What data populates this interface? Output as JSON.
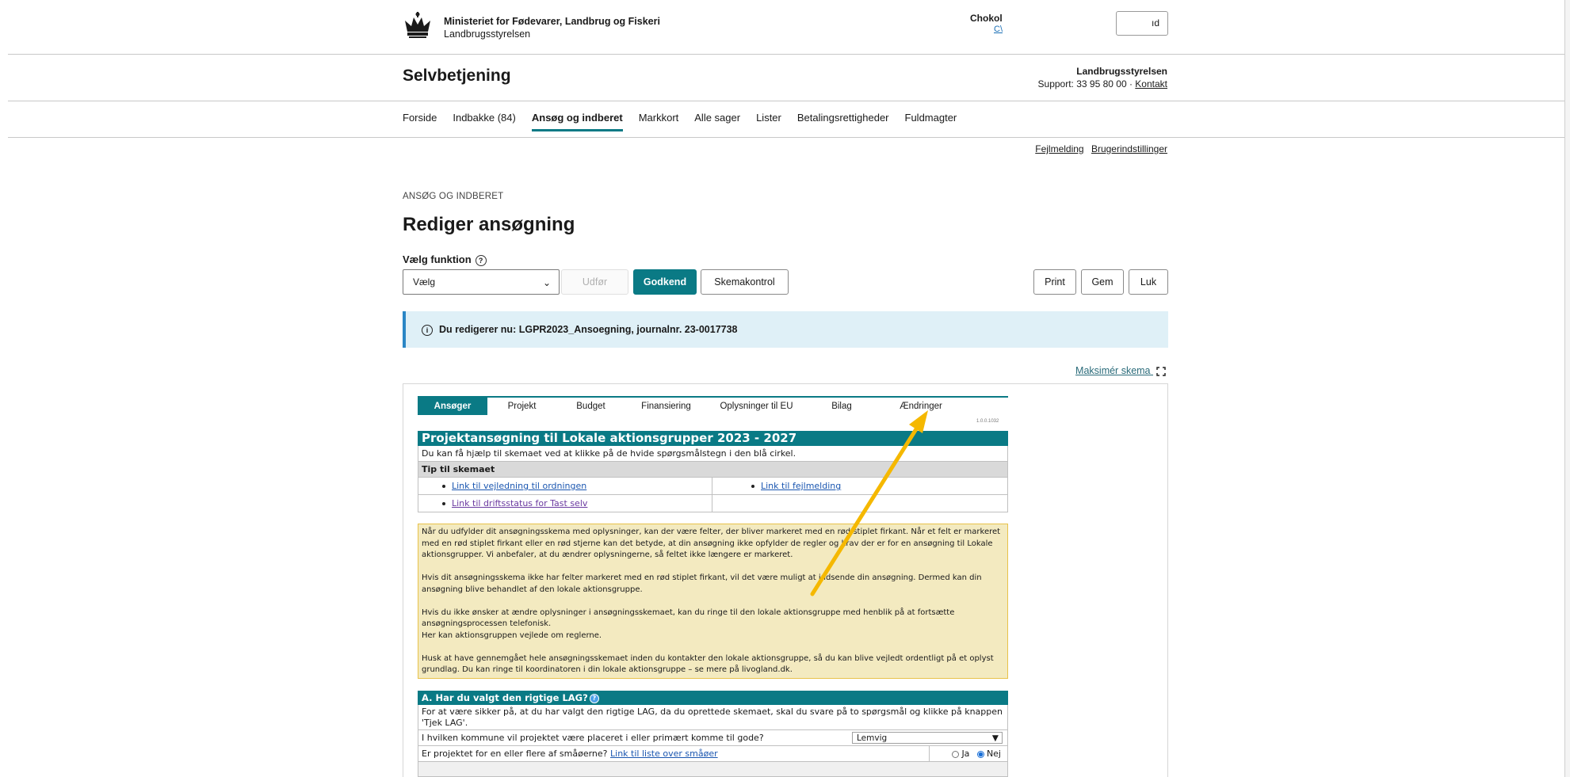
{
  "header": {
    "ministry_name": "Ministeriet for Fødevarer, Landbrug og Fiskeri",
    "agency_name": "Landbrugsstyrelsen",
    "user_name": "Chokol",
    "user_link": "C\\",
    "logout_label": "ıd"
  },
  "app": {
    "title": "Selvbetjening",
    "support_org": "Landbrugsstyrelsen",
    "support_prefix": "Support: 33 95 80 00 · ",
    "support_contact": "Kontakt"
  },
  "nav": {
    "items": [
      {
        "label": "Forside",
        "active": false
      },
      {
        "label": "Indbakke (84)",
        "active": false
      },
      {
        "label": "Ansøg og indberet",
        "active": true
      },
      {
        "label": "Markkort",
        "active": false
      },
      {
        "label": "Alle sager",
        "active": false
      },
      {
        "label": "Lister",
        "active": false
      },
      {
        "label": "Betalingsrettigheder",
        "active": false
      },
      {
        "label": "Fuldmagter",
        "active": false
      }
    ],
    "util_links": [
      "Fejlmelding",
      "Brugerindstillinger"
    ]
  },
  "page": {
    "breadcrumb": "ANSØG OG INDBERET",
    "title": "Rediger ansøgning",
    "function_label": "Vælg funktion",
    "select_value": "Vælg",
    "execute_label": "Udfør",
    "approve_label": "Godkend",
    "check_label": "Skemakontrol",
    "print_label": "Print",
    "save_label": "Gem",
    "close_label": "Luk",
    "info_banner": "Du redigerer nu: LGPR2023_Ansoegning, journalnr. 23-0017738",
    "maximize_label": "Maksimér skema"
  },
  "form": {
    "tabs": [
      "Ansøger",
      "Projekt",
      "Budget",
      "Finansiering",
      "Oplysninger til EU",
      "Bilag",
      "Ændringer"
    ],
    "active_tab": 0,
    "version": "1.0.0.1032",
    "title": "Projektansøgning til Lokale aktionsgrupper 2023 - 2027",
    "help_text": "Du kan få hjælp til skemaet ved at klikke på de hvide spørgsmålstegn i den blå cirkel.",
    "tip_header": "Tip til skemaet",
    "links": {
      "guide": "Link til vejledning til ordningen",
      "error_report": "Link til fejlmelding",
      "status": "Link til driftsstatus for Tast selv"
    },
    "note_paragraphs": [
      "Når du udfylder dit ansøgningsskema med oplysninger, kan der være felter, der bliver markeret med en rød stiplet firkant. Når et felt er markeret med en rød stiplet firkant eller en rød stjerne kan det betyde, at din ansøgning ikke opfylder de regler og krav der er for en ansøgning til Lokale aktionsgrupper. Vi anbefaler, at du ændrer oplysningerne, så feltet ikke længere er markeret.",
      "Hvis dit ansøgningsskema ikke har felter markeret med en rød stiplet firkant, vil det være muligt at indsende din ansøgning. Dermed kan din ansøgning blive behandlet af den lokale aktionsgruppe.",
      "Hvis du ikke ønsker at ændre oplysninger i ansøgningsskemaet, kan du ringe til den lokale aktionsgruppe med henblik på at fortsætte ansøgningsprocessen telefonisk.\nHer kan aktionsgruppen vejlede om reglerne.",
      "Husk at have gennemgået hele ansøgningsskemaet inden du kontakter den lokale aktionsgruppe, så du kan blive vejledt ordentligt på et oplyst grundlag. Du kan ringe til koordinatoren i din lokale aktionsgruppe – se mere på livogland.dk."
    ],
    "section_a_title": "A. Har du valgt den rigtige LAG?",
    "section_a_desc": "For at være sikker på, at du har valgt den rigtige LAG, da du oprettede skemaet, skal du svare på to spørgsmål og klikke på knappen 'Tjek LAG'.",
    "q1_label": "I hvilken kommune vil projektet være placeret i eller primært komme til gode?",
    "q1_value": "Lemvig",
    "q2_label": "Er projektet for en eller flere af småøerne?",
    "q2_link": "Link til liste over småøer",
    "q2_yes": "Ja",
    "q2_no": "Nej",
    "q2_selected": "Nej"
  },
  "colors": {
    "accent": "#0a7a85",
    "info_bg": "#dff0f7",
    "note_bg": "#f3eac0",
    "annotation_arrow": "#f5b800"
  }
}
